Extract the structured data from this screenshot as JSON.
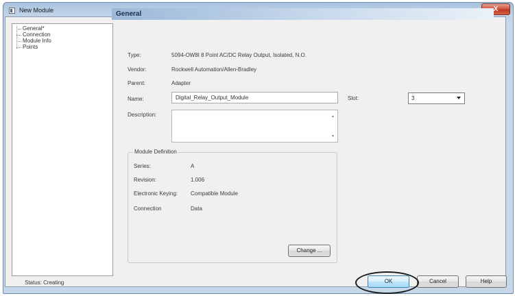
{
  "window": {
    "title": "New Module",
    "close_label": "X"
  },
  "tree": {
    "items": [
      "General*",
      "Connection",
      "Module Info",
      "Points"
    ]
  },
  "general": {
    "header": "General",
    "type_label": "Type:",
    "type_value": "5094-OW8I 8 Point AC/DC Relay Output, Isolated, N.O.",
    "vendor_label": "Vendor:",
    "vendor_value": "Rockwell Automation/Allen-Bradley",
    "parent_label": "Parent:",
    "parent_value": "Adapter",
    "name_label": "Name:",
    "name_value": "Digital_Relay_Output_Module",
    "slot_label": "Slot:",
    "slot_value": "3",
    "description_label": "Description:",
    "description_value": ""
  },
  "module_definition": {
    "title": "Module Definition",
    "series_label": "Series:",
    "series_value": "A",
    "revision_label": "Revision:",
    "revision_value": "1.006",
    "keying_label": "Electronic Keying:",
    "keying_value": "Compatible Module",
    "connection_label": "Connection",
    "connection_value": "Data",
    "change_label": "Change ..."
  },
  "footer": {
    "status": "Status: Creating",
    "ok_label": "OK",
    "cancel_label": "Cancel",
    "help_label": "Help"
  },
  "colors": {
    "title_bar": "#bfd3e8",
    "header_gradient_start": "#9cb8d8",
    "close_button": "#c03a25",
    "ok_button_border": "#3c7fb1"
  }
}
